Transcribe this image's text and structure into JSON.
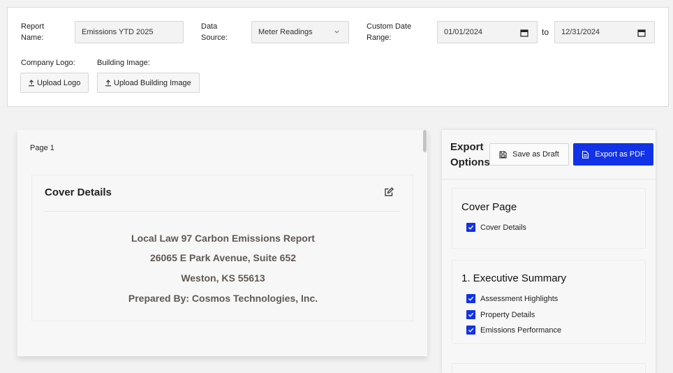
{
  "form": {
    "report_name_label": "Report Name:",
    "report_name_value": "Emissions YTD 2025",
    "data_source_label": "Data Source:",
    "data_source_value": "Meter Readings",
    "date_range_label": "Custom Date Range:",
    "date_from": "01/01/2024",
    "to_label": "to",
    "date_to": "12/31/2024",
    "company_logo_label": "Company Logo:",
    "upload_logo_label": "Upload Logo",
    "building_image_label": "Building Image:",
    "upload_building_label": "Upload Building Image"
  },
  "preview": {
    "page_label": "Page 1",
    "cover_title": "Cover Details",
    "lines": [
      "Local Law 97 Carbon Emissions Report",
      "26065 E Park Avenue, Suite 652",
      "Weston, KS 55613",
      "Prepared By: Cosmos Technologies, Inc."
    ]
  },
  "export": {
    "title": "Export Options",
    "save_draft_label": "Save as Draft",
    "export_pdf_label": "Export as PDF",
    "sections": [
      {
        "title": "Cover Page",
        "items": [
          {
            "label": "Cover Details",
            "checked": true
          }
        ]
      },
      {
        "title": "1. Executive Summary",
        "items": [
          {
            "label": "Assessment Highlights",
            "checked": true
          },
          {
            "label": "Property Details",
            "checked": true
          },
          {
            "label": "Emissions Performance",
            "checked": true
          }
        ]
      }
    ]
  },
  "colors": {
    "accent": "#1232e8",
    "cover_text": "#5f5953"
  }
}
